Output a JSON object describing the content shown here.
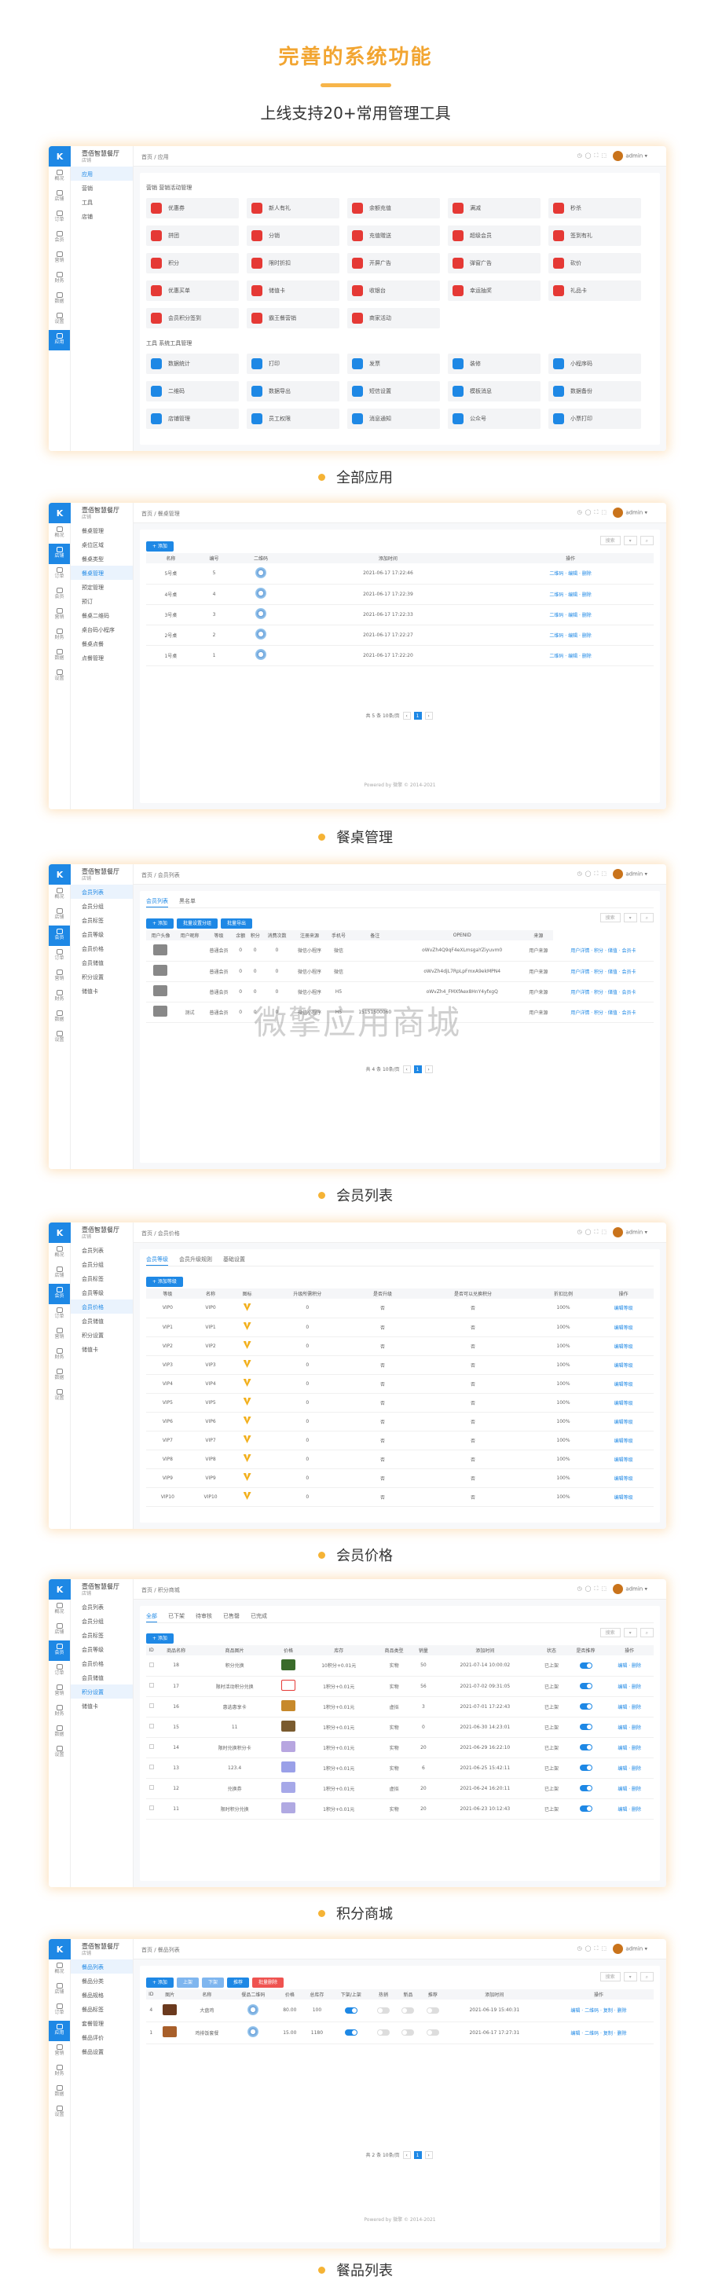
{
  "hero": {
    "title": "完善的系统功能",
    "subtitle": "上线支持20+常用管理工具"
  },
  "rail": [
    "概况",
    "店铺",
    "应用",
    "订单",
    "会员",
    "营销",
    "财务",
    "数据",
    "设置"
  ],
  "brand": {
    "name": "壹佰智慧餐厅",
    "sub": "店铺"
  },
  "user": "admin",
  "sections": [
    {
      "caption": "全部应用",
      "breadcrumb": "首页 / 应用"
    },
    {
      "caption": "餐桌管理",
      "breadcrumb": "首页 / 餐桌管理"
    },
    {
      "caption": "会员列表",
      "breadcrumb": "首页 / 会员列表"
    },
    {
      "caption": "会员价格",
      "breadcrumb": "首页 / 会员价格"
    },
    {
      "caption": "积分商城",
      "breadcrumb": "首页 / 积分商城"
    },
    {
      "caption": "餐品列表",
      "breadcrumb": "首页 / 餐品列表"
    }
  ],
  "apps": {
    "sidebar": [
      "应用",
      "营销",
      "工具",
      "店铺"
    ],
    "group1": "营销  营销活动管理",
    "group2": "工具  系统工具管理",
    "marketing": [
      "优惠券",
      "新人有礼",
      "余额充值",
      "满减",
      "秒杀",
      "拼团",
      "分销",
      "充值赠送",
      "超级会员",
      "签到有礼",
      "积分",
      "限时折扣",
      "开屏广告",
      "弹窗广告",
      "砍价",
      "优惠买单",
      "储值卡",
      "收银台",
      "幸运抽奖",
      "礼品卡",
      "会员积分签到",
      "霸王餐营销",
      "商家活动"
    ],
    "tools": [
      "数据统计",
      "打印",
      "发票",
      "装修",
      "小程序码",
      "二维码",
      "数据导出",
      "短信设置",
      "模板消息",
      "数据备份",
      "店铺管理",
      "员工权限",
      "消息通知",
      "公众号",
      "小票打印"
    ]
  },
  "tables_page": {
    "sidebar": [
      "餐桌管理",
      "桌位区域",
      "餐桌类型",
      "餐桌管理",
      "预定管理",
      "预订",
      "餐桌二维码",
      "桌台码小程序",
      "餐桌点餐",
      "点餐管理"
    ],
    "add": "+ 添加",
    "search": "搜索",
    "headers": [
      "名称",
      "编号",
      "二维码",
      "添加时间",
      "操作"
    ],
    "rows": [
      [
        "5号桌",
        "5",
        "2021-06-17 17:22:46"
      ],
      [
        "4号桌",
        "4",
        "2021-06-17 17:22:39"
      ],
      [
        "3号桌",
        "3",
        "2021-06-17 17:22:33"
      ],
      [
        "2号桌",
        "2",
        "2021-06-17 17:22:27"
      ],
      [
        "1号桌",
        "1",
        "2021-06-17 17:22:20"
      ]
    ],
    "ops": "二维码 · 编辑 · 删除",
    "pager": "共 5 条   10条/页",
    "footer": "Powered by 微擎 © 2014-2021"
  },
  "members_page": {
    "sidebar": [
      "会员列表",
      "会员分组",
      "会员标签",
      "会员等级",
      "会员价格",
      "会员储值",
      "积分设置",
      "储值卡"
    ],
    "tabs": [
      "会员列表",
      "黑名单"
    ],
    "btns": [
      "+ 添加",
      "批量设置分组",
      "批量导出"
    ],
    "headers": [
      "用户头像",
      "用户昵称",
      "等级",
      "余额",
      "积分",
      "消费次数",
      "注册来源",
      "手机号",
      "备注",
      "OPENID",
      "来源"
    ],
    "rows": [
      [
        "",
        "普通会员",
        "0",
        "0",
        "0",
        "微信小程序",
        "微信",
        "",
        "oWvZh4Q9qF4eXLmsgaYZiyuvm0",
        "用户来源"
      ],
      [
        "",
        "普通会员",
        "0",
        "0",
        "0",
        "微信小程序",
        "微信",
        "",
        "oWvZh4djL7RpLpFmxA9ekMPN4",
        "用户来源"
      ],
      [
        "",
        "普通会员",
        "0",
        "0",
        "0",
        "微信小程序",
        "H5",
        "",
        "oWvZh4_FMXfAex8HnY4yfxgQ",
        "用户来源"
      ],
      [
        "测试",
        "普通会员",
        "0",
        "0",
        "0",
        "微信小程序",
        "H5",
        "15151500060",
        "",
        "用户来源"
      ]
    ],
    "ops": "用户详情 · 积分 · 储值 · 会员卡",
    "watermark": "微擎应用商城"
  },
  "vip_page": {
    "tabs": [
      "会员等级",
      "会员升级规则",
      "基础设置"
    ],
    "add": "+ 添加等级",
    "headers": [
      "等级",
      "名称",
      "图标",
      "升级所需积分",
      "是否升级",
      "是否可以兑换积分",
      "折扣比例",
      "操作"
    ],
    "rows": [
      [
        "VIP0",
        "VIP0",
        "0",
        "否",
        "否",
        "100%"
      ],
      [
        "VIP1",
        "VIP1",
        "0",
        "否",
        "否",
        "100%"
      ],
      [
        "VIP2",
        "VIP2",
        "0",
        "否",
        "否",
        "100%"
      ],
      [
        "VIP3",
        "VIP3",
        "0",
        "否",
        "否",
        "100%"
      ],
      [
        "VIP4",
        "VIP4",
        "0",
        "否",
        "否",
        "100%"
      ],
      [
        "VIP5",
        "VIP5",
        "0",
        "否",
        "否",
        "100%"
      ],
      [
        "VIP6",
        "VIP6",
        "0",
        "否",
        "否",
        "100%"
      ],
      [
        "VIP7",
        "VIP7",
        "0",
        "否",
        "否",
        "100%"
      ],
      [
        "VIP8",
        "VIP8",
        "0",
        "否",
        "否",
        "100%"
      ],
      [
        "VIP9",
        "VIP9",
        "0",
        "否",
        "否",
        "100%"
      ],
      [
        "VIP10",
        "VIP10",
        "0",
        "否",
        "否",
        "100%"
      ]
    ],
    "op": "编辑等级"
  },
  "points_page": {
    "tabs": [
      "全部",
      "已下架",
      "待审核",
      "已售罄",
      "已完成"
    ],
    "add": "+ 添加",
    "headers": [
      "ID",
      "商品名称",
      "商品图片",
      "价格",
      "库存",
      "商品类型",
      "销量",
      "添加时间",
      "状态",
      "是否推荐",
      "操作"
    ],
    "rows": [
      [
        "18",
        "积分兑换",
        "10积分+0.01元",
        "实物",
        "50",
        "2021-07-14 10:00:02",
        "已上架"
      ],
      [
        "17",
        "限时活动积分兑换",
        "1积分+0.01元",
        "实物",
        "56",
        "2021-07-02 09:31:05",
        "已上架"
      ],
      [
        "16",
        "惠选惠享卡",
        "1积分+0.01元",
        "虚拟",
        "3",
        "2021-07-01 17:22:43",
        "已上架"
      ],
      [
        "15",
        "11",
        "1积分+0.01元",
        "实物",
        "0",
        "2021-06-30 14:23:01",
        "已上架"
      ],
      [
        "14",
        "限时兑换积分卡",
        "1积分+0.01元",
        "实物",
        "20",
        "2021-06-29 16:22:10",
        "已上架"
      ],
      [
        "13",
        "123.4",
        "1积分+0.01元",
        "实物",
        "6",
        "2021-06-25 15:42:11",
        "已上架"
      ],
      [
        "12",
        "兑换券",
        "1积分+0.01元",
        "虚拟",
        "20",
        "2021-06-24 16:20:11",
        "已上架"
      ],
      [
        "11",
        "限时积分兑换",
        "1积分+0.01元",
        "实物",
        "20",
        "2021-06-23 10:12:43",
        "已上架"
      ]
    ],
    "ops": "编辑 · 删除"
  },
  "dish_page": {
    "sidebar": [
      "餐品列表",
      "餐品分类",
      "餐品规格",
      "餐品标签",
      "套餐管理",
      "餐品评价",
      "餐品设置"
    ],
    "btns": [
      "+ 添加",
      "上架",
      "下架",
      "推荐",
      "批量删除"
    ],
    "headers": [
      "ID",
      "图片",
      "名称",
      "餐品二维码",
      "价格",
      "总库存",
      "下架/上架",
      "热销",
      "新品",
      "推荐",
      "添加时间",
      "操作"
    ],
    "rows": [
      [
        "4",
        "大盘鸡",
        "80.00",
        "100",
        "2021-06-19 15:40:31"
      ],
      [
        "1",
        "鸡排饭套餐",
        "15.00",
        "1180",
        "2021-06-17 17:27:31"
      ]
    ],
    "ops": "编辑 · 二维码 · 复制 · 删除",
    "pager": "共 2 条   10条/页"
  }
}
